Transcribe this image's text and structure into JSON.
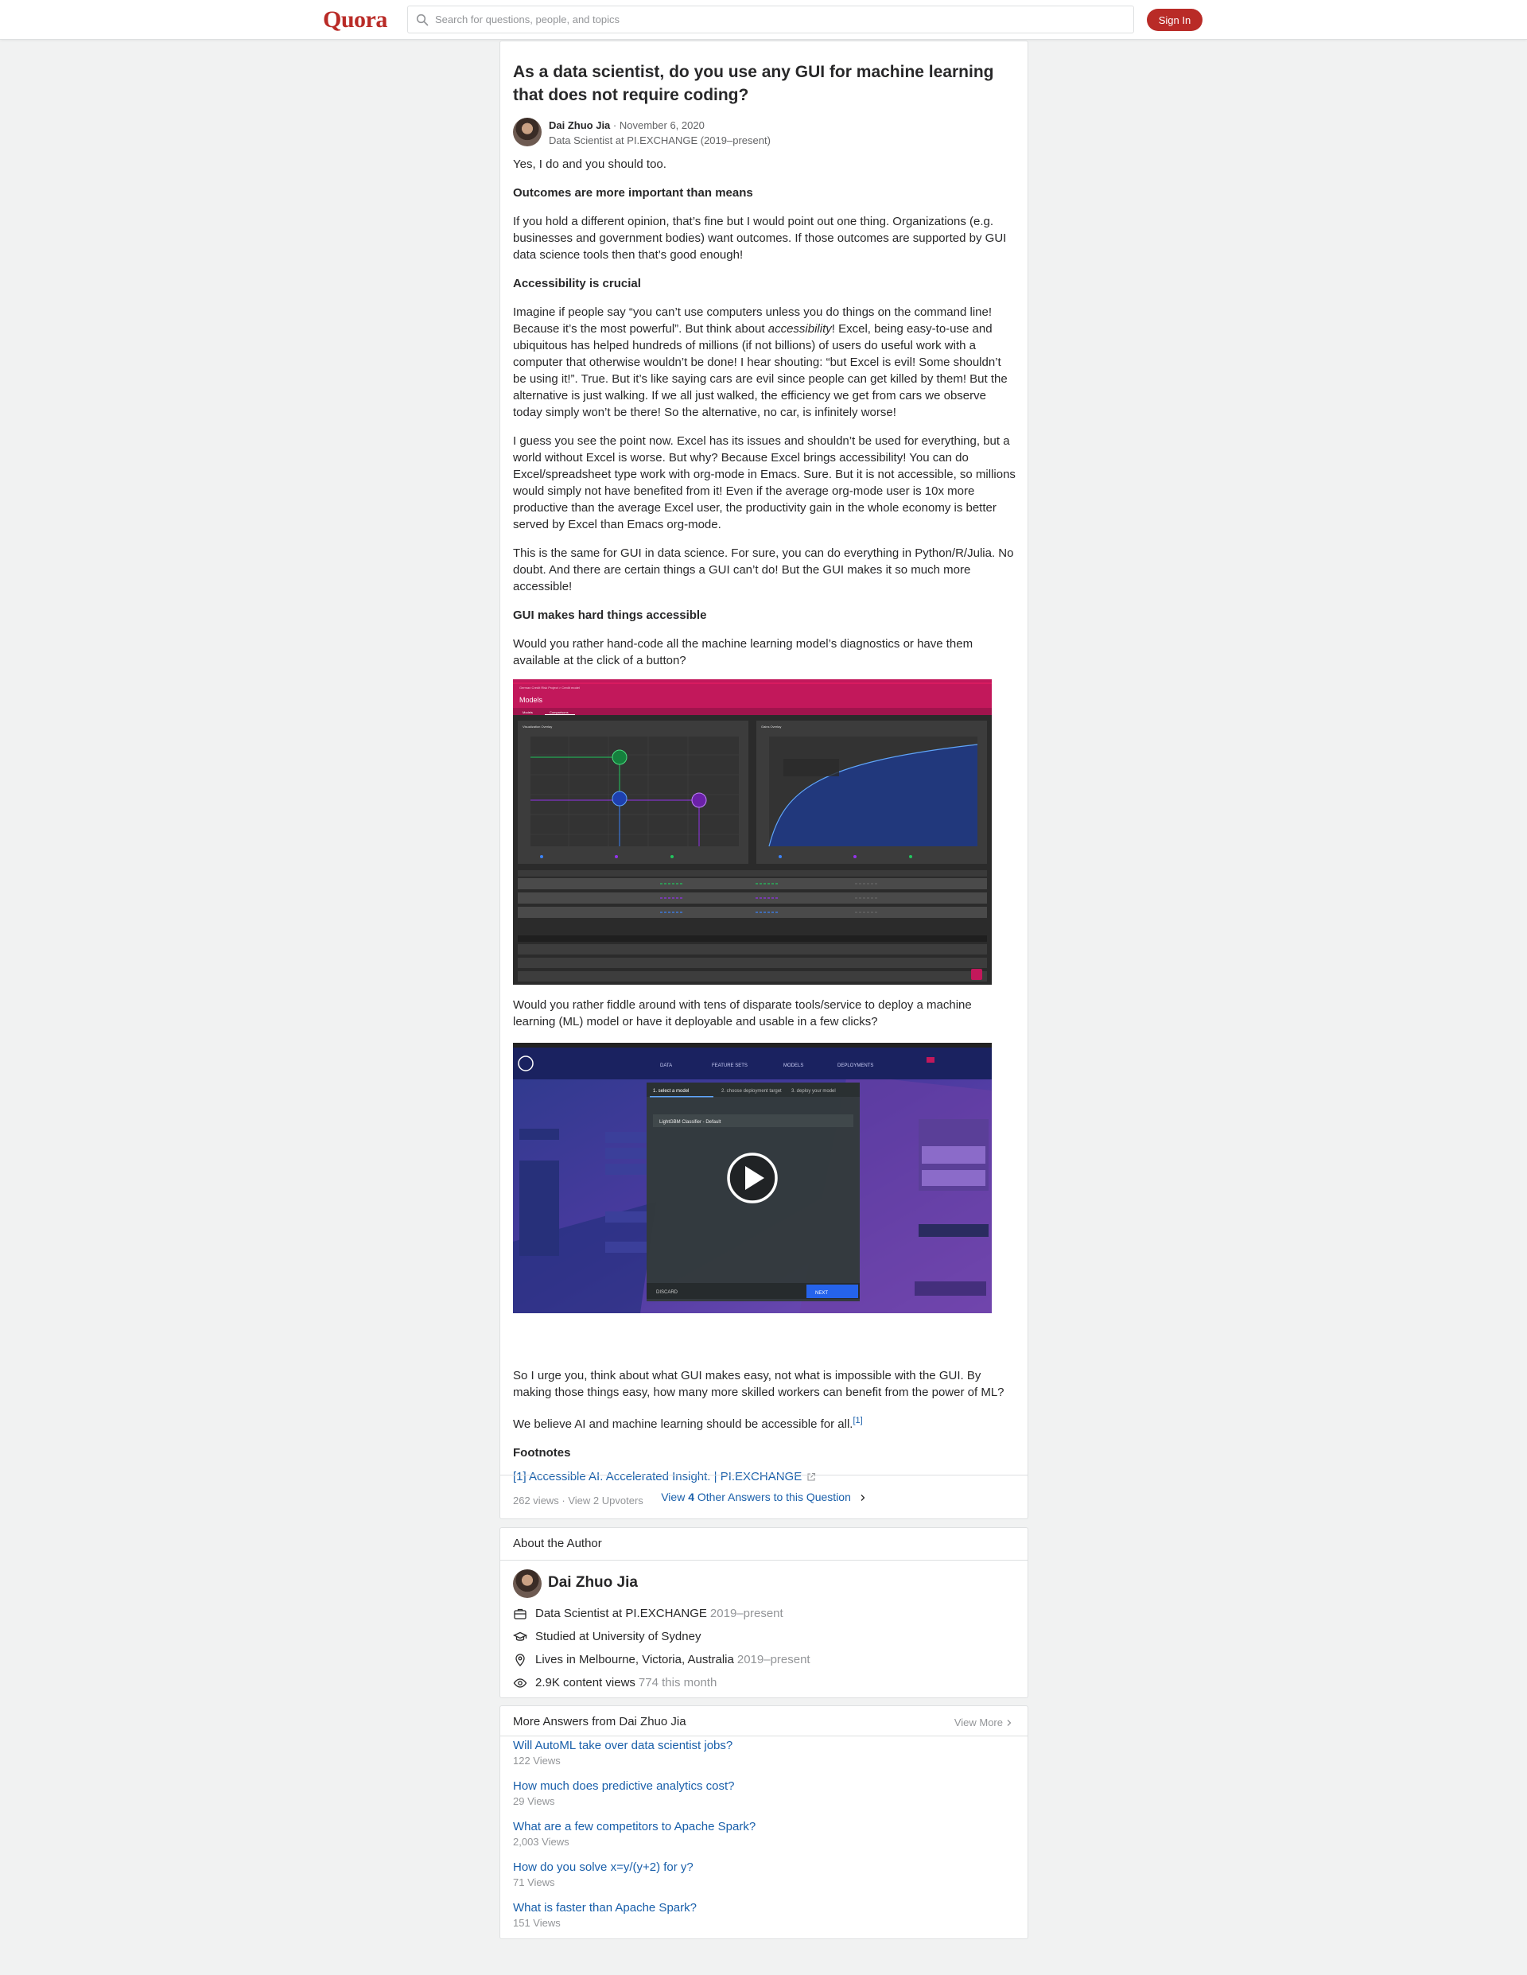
{
  "header": {
    "logo": "Quora",
    "search_placeholder": "Search for questions, people, and topics",
    "signin_label": "Sign In"
  },
  "question": "As a data scientist, do you use any GUI for machine learning that does not require coding?",
  "author": {
    "name": "Dai Zhuo Jia",
    "date": "November 6, 2020",
    "credential": "Data Scientist at PI.EXCHANGE (2019–present)"
  },
  "answer": {
    "p1": "Yes, I do and you should too.",
    "h1": "Outcomes are more important than means",
    "p2": "If you hold a different opinion, that’s fine but I would point out one thing. Organizations (e.g. businesses and government bodies) want outcomes. If those outcomes are supported by GUI data science tools then that’s good enough!",
    "h2": "Accessibility is crucial",
    "p3a": "Imagine if people say “you can’t use computers unless you do things on the command line! Because it’s the most powerful”. But think about ",
    "p3em": "accessibility",
    "p3b": "! Excel, being easy-to-use and ubiquitous has helped hundreds of millions (if not billions) of users do useful work with a computer that otherwise wouldn’t be done! I hear shouting: “but Excel is evil! Some shouldn’t be using it!”. True. But it’s like saying cars are evil since people can get killed by them! But the alternative is just walking. If we all just walked, the efficiency we get from cars we observe today simply won’t be there! So the alternative, no car, is infinitely worse!",
    "p4": "I guess you see the point now. Excel has its issues and shouldn’t be used for everything, but a world without Excel is worse. But why? Because Excel brings accessibility! You can do Excel/spreadsheet type work with org-mode in Emacs. Sure. But it is not accessible, so millions would simply not have benefited from it! Even if the average org-mode user is 10x more productive than the average Excel user, the productivity gain in the whole economy is better served by Excel than Emacs org-mode.",
    "p5": "This is the same for GUI in data science. For sure, you can do everything in Python/R/Julia. No doubt. And there are certain things a GUI can’t do! But the GUI makes it so much more accessible!",
    "h3": "GUI makes hard things accessible",
    "p6": "Would you rather hand-code all the machine learning model’s diagnostics or have them available at the click of a button?",
    "p7": "Would you rather fiddle around with tens of disparate tools/service to deploy a machine learning (ML) model or have it deployable and usable in a few clicks?",
    "p8": "So I urge you, think about what GUI makes easy, not what is impossible with the GUI. By making those things easy, how many more skilled workers can benefit from the power of ML?",
    "p9": "We believe AI and machine learning should be accessible for all.",
    "p9_ref": "[1]",
    "footnotes_title": "Footnotes",
    "footnote1": "[1] Accessible AI. Accelerated Insight. | PI.EXCHANGE",
    "stats": "262 views · View 2 Upvoters"
  },
  "screenshot1": {
    "page_title": "Models",
    "tab1": "Models",
    "tab2": "Comparisons",
    "left_panel_title": "Visualization Overlay",
    "right_panel_title": "Gains Overlay"
  },
  "screenshot2": {
    "nav": [
      "DATA",
      "FEATURE SETS",
      "MODELS",
      "DEPLOYMENTS"
    ],
    "dialog_tabs": [
      "1. select a model",
      "2. choose deployment target",
      "3. deploy your model"
    ],
    "dialog_select": "LightGBM Classifier - Default",
    "discard_label": "DISCARD",
    "next_label": "NEXT"
  },
  "view_others": {
    "prefix": "View ",
    "count": "4",
    "suffix": " Other Answers to this Question"
  },
  "about": {
    "title": "About the Author",
    "name": "Dai Zhuo Jia",
    "work": "Data Scientist at PI.EXCHANGE",
    "work_years": "2019–present",
    "study": "Studied at University of Sydney",
    "lives": "Lives in Melbourne, Victoria, Australia",
    "lives_years": "2019–present",
    "views": "2.9K content views",
    "views_month": "774 this month"
  },
  "more_answers": {
    "title": "More Answers from Dai Zhuo Jia",
    "view_more": "View More",
    "items": [
      {
        "q": "Will AutoML take over data scientist jobs?",
        "views": "122 Views"
      },
      {
        "q": "How much does predictive analytics cost?",
        "views": "29 Views"
      },
      {
        "q": "What are a few competitors to Apache Spark?",
        "views": "2,003 Views"
      },
      {
        "q": "How do you solve x=y/(y+2) for y?",
        "views": "71 Views"
      },
      {
        "q": "What is faster than Apache Spark?",
        "views": "151 Views"
      }
    ]
  },
  "colors": {
    "brand": "#b92b27",
    "link": "#195faa",
    "magenta": "#c2185b"
  }
}
